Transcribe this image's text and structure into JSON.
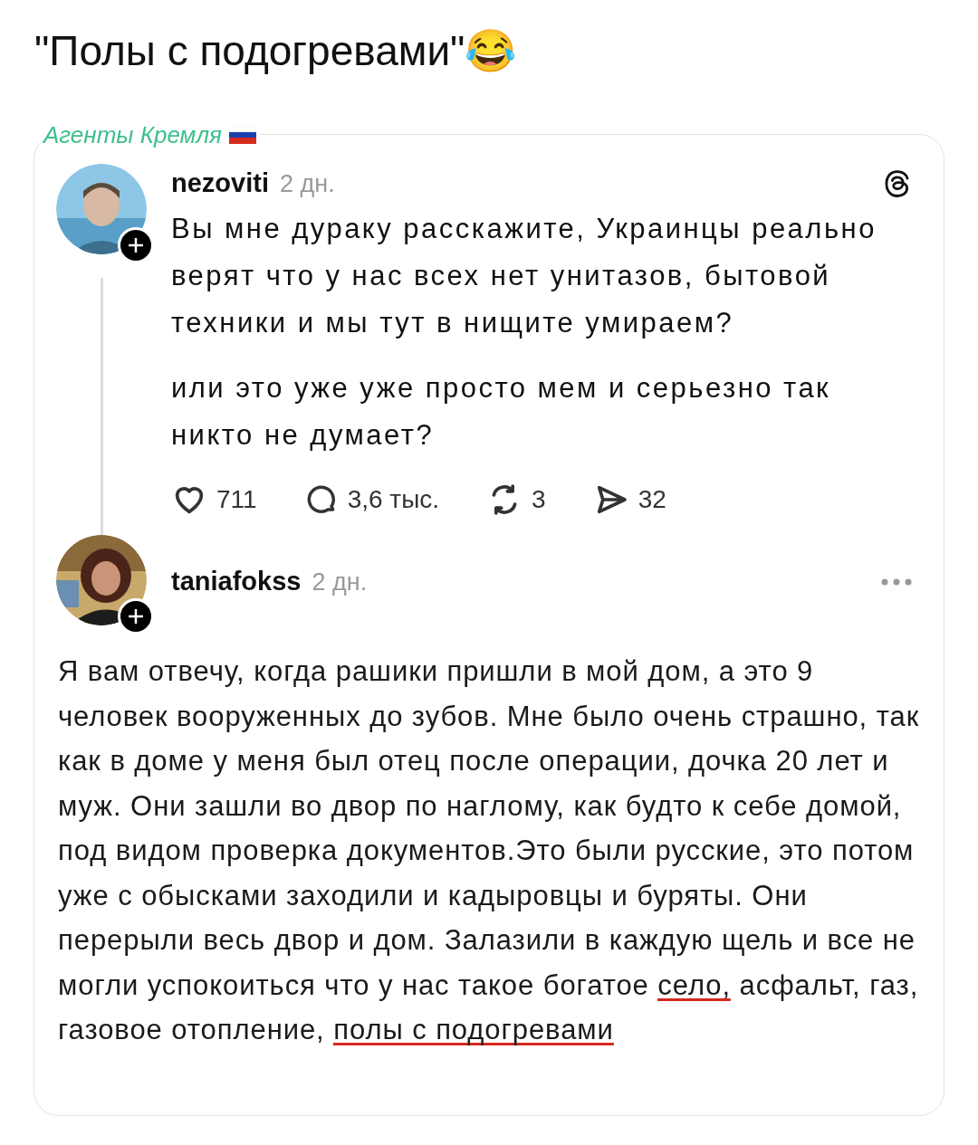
{
  "caption": "\"Полы с подогревами\"😂",
  "channel_label": "Агенты Кремля",
  "post": {
    "username": "nezoviti",
    "time": "2 дн.",
    "paragraphs": [
      "Вы мне дураку расскажите, Украинцы реально верят что у нас всех нет унитазов, бытовой техники и мы тут в нищите умираем?",
      "или это уже уже просто мем и серьезно так никто не думает?"
    ],
    "actions": [
      {
        "kind": "like",
        "count": "711"
      },
      {
        "kind": "comment",
        "count": "3,6 тыс."
      },
      {
        "kind": "repost",
        "count": "3"
      },
      {
        "kind": "share",
        "count": "32"
      }
    ]
  },
  "reply": {
    "username": "taniafokss",
    "time": "2 дн.",
    "segments": [
      {
        "text": "Я вам отвечу, когда рашики пришли в мой дом, а это 9 человек вооруженных до зубов. Мне было очень страшно, так как в доме у меня был отец после операции, дочка 20 лет и муж. Они зашли во двор по наглому, как будто к себе домой, под видом проверка документов.Это были русские, это потом уже с обысками заходили и кадыровцы и буряты. Они перерыли весь двор и дом. Залазили в каждую щель и все не могли успокоиться что у нас такое богатое",
        "underlined": false
      },
      {
        "text": "село,",
        "underlined": true
      },
      {
        "text": "асфальт, газ, газовое отопление,",
        "underlined": false
      },
      {
        "text": "полы с подогревами",
        "underlined": true
      }
    ]
  }
}
